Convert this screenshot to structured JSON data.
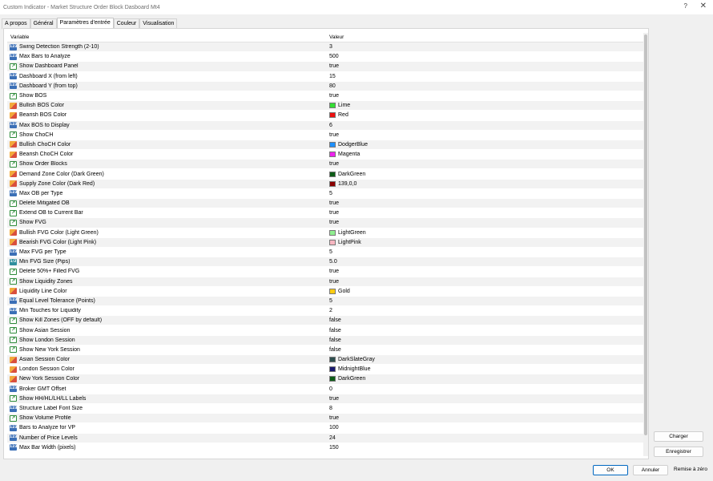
{
  "window": {
    "title": "Custom Indicator - Market Structure Order Block Dasboard Mt4",
    "help": "?",
    "close": "✕"
  },
  "tabs": [
    "A propos",
    "Général",
    "Paramètres d'entrée",
    "Couleur",
    "Visualisation"
  ],
  "active_tab": 2,
  "table": {
    "headers": {
      "variable": "Variable",
      "value": "Valeur"
    },
    "rows": [
      {
        "type": "int",
        "label": "Swing Detection Strength (2-10)",
        "value": "3"
      },
      {
        "type": "int",
        "label": "Max Bars to Analyze",
        "value": "500"
      },
      {
        "type": "bool",
        "label": "Show Dashboard Panel",
        "value": "true"
      },
      {
        "type": "int",
        "label": "Dashboard X (from left)",
        "value": "15"
      },
      {
        "type": "int",
        "label": "Dashboard Y (from top)",
        "value": "80"
      },
      {
        "type": "bool",
        "label": "Show BOS",
        "value": "true"
      },
      {
        "type": "color",
        "label": "Bullish BOS Color",
        "value": "Lime",
        "swatch": "#33dd33"
      },
      {
        "type": "color",
        "label": "Bearish BOS Color",
        "value": "Red",
        "swatch": "#ee1111"
      },
      {
        "type": "int",
        "label": "Max BOS to Display",
        "value": "6"
      },
      {
        "type": "bool",
        "label": "Show ChoCH",
        "value": "true"
      },
      {
        "type": "color",
        "label": "Bullish ChoCH Color",
        "value": "DodgerBlue",
        "swatch": "#1e90ff"
      },
      {
        "type": "color",
        "label": "Bearish ChoCH Color",
        "value": "Magenta",
        "swatch": "#ee22ee"
      },
      {
        "type": "bool",
        "label": "Show Order Blocks",
        "value": "true"
      },
      {
        "type": "color",
        "label": "Demand Zone Color (Dark Green)",
        "value": "DarkGreen",
        "swatch": "#0d5c17"
      },
      {
        "type": "color",
        "label": "Supply Zone Color (Dark Red)",
        "value": "139,0,0",
        "swatch": "#8b0000"
      },
      {
        "type": "int",
        "label": "Max OB per Type",
        "value": "5"
      },
      {
        "type": "bool",
        "label": "Delete Mitigated OB",
        "value": "true"
      },
      {
        "type": "bool",
        "label": "Extend OB to Current Bar",
        "value": "true"
      },
      {
        "type": "bool",
        "label": "Show FVG",
        "value": "true"
      },
      {
        "type": "color",
        "label": "Bullish FVG Color (Light Green)",
        "value": "LightGreen",
        "swatch": "#90ee90"
      },
      {
        "type": "color",
        "label": "Bearish FVG Color (Light Pink)",
        "value": "LightPink",
        "swatch": "#f7b6c1"
      },
      {
        "type": "int",
        "label": "Max FVG per Type",
        "value": "5"
      },
      {
        "type": "dbl",
        "label": "Min FVG Size (Pips)",
        "value": "5.0"
      },
      {
        "type": "bool",
        "label": "Delete 50%+ Filled FVG",
        "value": "true"
      },
      {
        "type": "bool",
        "label": "Show Liquidity Zones",
        "value": "true"
      },
      {
        "type": "color",
        "label": "Liquidity Line Color",
        "value": "Gold",
        "swatch": "#ffcc11"
      },
      {
        "type": "int",
        "label": "Equal Level Tolerance (Points)",
        "value": "5"
      },
      {
        "type": "int",
        "label": "Min Touches for Liquidity",
        "value": "2"
      },
      {
        "type": "bool",
        "label": "Show Kill Zones (OFF by default)",
        "value": "false"
      },
      {
        "type": "bool",
        "label": "Show Asian Session",
        "value": "false"
      },
      {
        "type": "bool",
        "label": "Show London Session",
        "value": "false"
      },
      {
        "type": "bool",
        "label": "Show New York Session",
        "value": "false"
      },
      {
        "type": "color",
        "label": "Asian Session Color",
        "value": "DarkSlateGray",
        "swatch": "#2f4f4f"
      },
      {
        "type": "color",
        "label": "London Session Color",
        "value": "MidnightBlue",
        "swatch": "#191970"
      },
      {
        "type": "color",
        "label": "New York Session Color",
        "value": "DarkGreen",
        "swatch": "#0d5c17"
      },
      {
        "type": "int",
        "label": "Broker GMT Offset",
        "value": "0"
      },
      {
        "type": "bool",
        "label": "Show HH/HL/LH/LL Labels",
        "value": "true"
      },
      {
        "type": "int",
        "label": "Structure Label Font Size",
        "value": "8"
      },
      {
        "type": "bool",
        "label": "Show Volume Profile",
        "value": "true"
      },
      {
        "type": "int",
        "label": "Bars to Analyze for VP",
        "value": "100"
      },
      {
        "type": "int",
        "label": "Number of Price Levels",
        "value": "24"
      },
      {
        "type": "int",
        "label": "Max Bar Width (pixels)",
        "value": "150"
      }
    ]
  },
  "icons": {
    "int": {
      "name": "integer-type-icon",
      "glyph": "123"
    },
    "dbl": {
      "name": "double-type-icon",
      "glyph": "1/2"
    },
    "bool": {
      "name": "boolean-type-icon",
      "glyph": "↗"
    },
    "color": {
      "name": "color-type-icon",
      "glyph": ""
    }
  },
  "buttons": {
    "charger": "Charger",
    "enregistrer": "Enregistrer",
    "ok": "OK",
    "annuler": "Annuler",
    "reset": "Remise à zéro"
  }
}
